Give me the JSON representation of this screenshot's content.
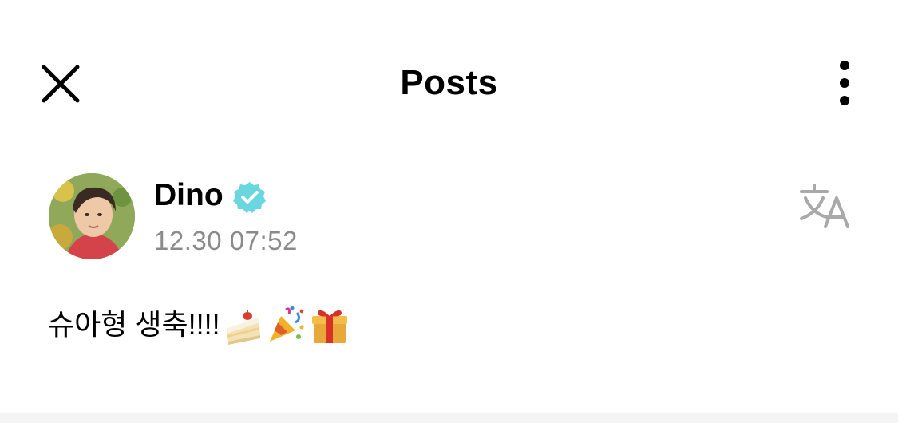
{
  "header": {
    "title": "Posts",
    "close_icon": "close-icon",
    "more_icon": "more-vertical-icon"
  },
  "post": {
    "author": {
      "name": "Dino",
      "verified": true,
      "verified_color": "#6ad6df"
    },
    "timestamp": "12.30 07:52",
    "translate_icon": "translate-icon",
    "text": "슈아형 생축!!!!",
    "emojis": [
      "🍰",
      "🎉",
      "🎁"
    ]
  },
  "colors": {
    "text": "#000000",
    "muted": "#8a8a8a",
    "icon_gray": "#a9a9a9",
    "divider": "#f4f4f4"
  }
}
